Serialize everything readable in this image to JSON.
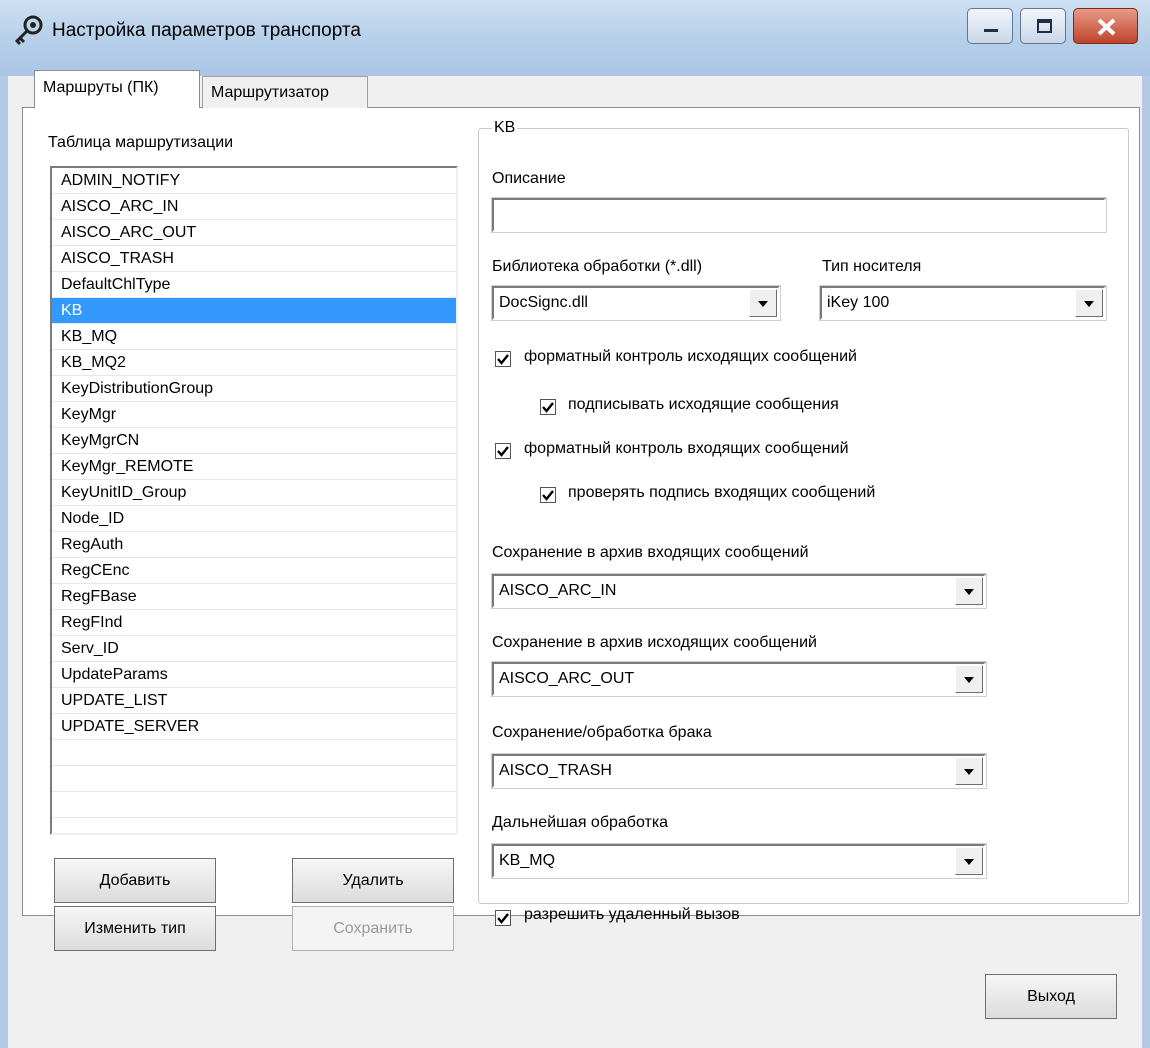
{
  "window": {
    "title": "Настройка параметров транспорта"
  },
  "tabs": [
    {
      "label": "Маршруты (ПК)",
      "active": true
    },
    {
      "label": "Маршрутизатор",
      "active": false
    }
  ],
  "routes": {
    "label": "Таблица маршрутизации",
    "items": [
      "ADMIN_NOTIFY",
      "AISCO_ARC_IN",
      "AISCO_ARC_OUT",
      "AISCO_TRASH",
      "DefaultChlType",
      "KB",
      "KB_MQ",
      "KB_MQ2",
      "KeyDistributionGroup",
      "KeyMgr",
      "KeyMgrCN",
      "KeyMgr_REMOTE",
      "KeyUnitID_Group",
      "Node_ID",
      "RegAuth",
      "RegCEnc",
      "RegFBase",
      "RegFInd",
      "Serv_ID",
      "UpdateParams",
      "UPDATE_LIST",
      "UPDATE_SERVER"
    ],
    "selected": "KB"
  },
  "buttons": {
    "add": "Добавить",
    "delete": "Удалить",
    "change_type": "Изменить тип",
    "save": "Сохранить",
    "exit": "Выход"
  },
  "group": {
    "title": "KB",
    "description_label": "Описание",
    "description_value": "",
    "library_label": "Библиотека обработки (*.dll)",
    "library_value": "DocSignc.dll",
    "media_label": "Тип носителя",
    "media_value": "iKey 100",
    "checks": {
      "outgoing_format": {
        "label": "форматный контроль исходящих сообщений",
        "checked": true
      },
      "sign_outgoing": {
        "label": "подписывать исходящие сообщения",
        "checked": true
      },
      "incoming_format": {
        "label": "форматный контроль входящих сообщений",
        "checked": true
      },
      "verify_incoming": {
        "label": "проверять подпись входящих сообщений",
        "checked": true
      },
      "remote_call": {
        "label": "разрешить удаленный вызов",
        "checked": true
      }
    },
    "archive_in_label": "Сохранение в архив входящих сообщений",
    "archive_in_value": "AISCO_ARC_IN",
    "archive_out_label": "Сохранение в архив исходящих сообщений",
    "archive_out_value": "AISCO_ARC_OUT",
    "reject_label": "Сохранение/обработка брака",
    "reject_value": "AISCO_TRASH",
    "further_label": "Дальнейшая обработка",
    "further_value": "KB_MQ"
  }
}
